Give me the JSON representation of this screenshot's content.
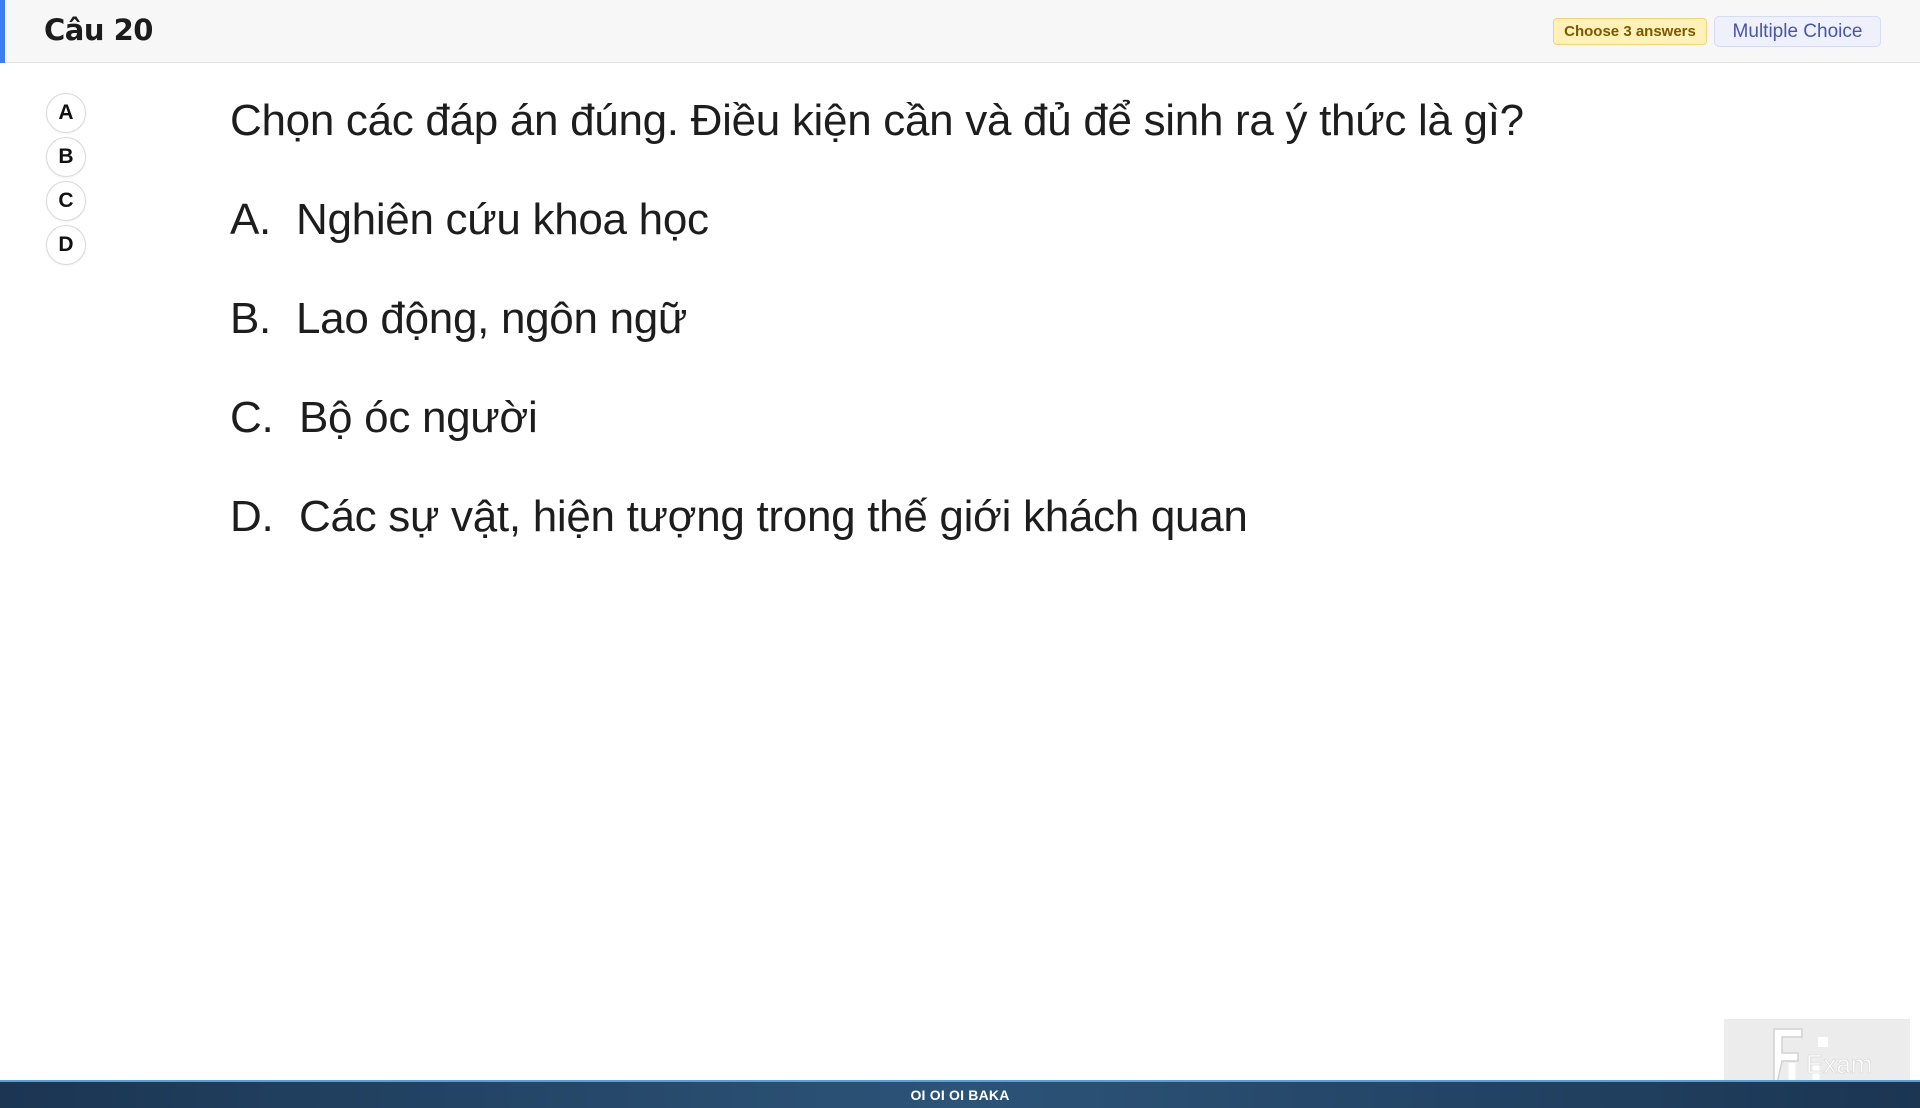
{
  "header": {
    "title": "Câu 20",
    "choose_badge": "Choose 3 answers",
    "type_badge": "Multiple Choice"
  },
  "selectors": [
    "A",
    "B",
    "C",
    "D"
  ],
  "question": {
    "text": "Chọn các đáp án đúng. Điều kiện cần và đủ để sinh ra ý thức là gì?",
    "options": [
      {
        "letter": "A.",
        "text": "Nghiên cứu khoa học"
      },
      {
        "letter": "B.",
        "text": "Lao động, ngôn ngữ"
      },
      {
        "letter": "C.",
        "text": "Bộ óc người"
      },
      {
        "letter": "D.",
        "text": "Các sự vật, hiện tượng trong thế giới khách quan"
      }
    ]
  },
  "logo": {
    "text": "Exam"
  },
  "footer": {
    "text": "OI OI OI BAKA"
  },
  "colors": {
    "accent": "#3d7df2",
    "badge_yellow": "#fff1b8",
    "footer_dark": "#1b3553"
  }
}
